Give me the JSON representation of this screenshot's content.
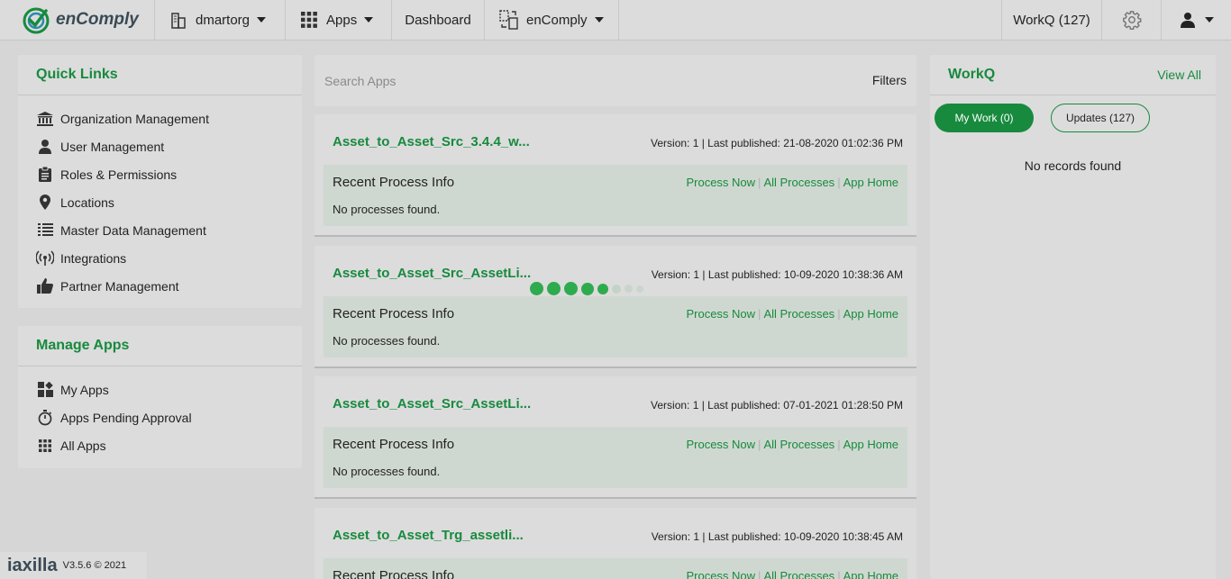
{
  "header": {
    "logo_text": "enComply",
    "org": "dmartorg",
    "apps_menu": "Apps",
    "dashboard": "Dashboard",
    "product": "enComply",
    "workq": "WorkQ (127)"
  },
  "quick_links": {
    "title": "Quick Links",
    "items": [
      {
        "label": "Organization Management",
        "icon": "bank-icon"
      },
      {
        "label": "User Management",
        "icon": "user-icon"
      },
      {
        "label": "Roles & Permissions",
        "icon": "clipboard-icon"
      },
      {
        "label": "Locations",
        "icon": "map-pin-icon"
      },
      {
        "label": "Master Data Management",
        "icon": "data-list-icon"
      },
      {
        "label": "Integrations",
        "icon": "broadcast-icon"
      },
      {
        "label": "Partner Management",
        "icon": "thumbs-up-icon"
      }
    ]
  },
  "manage_apps": {
    "title": "Manage Apps",
    "items": [
      {
        "label": "My Apps",
        "icon": "app-tiles-icon"
      },
      {
        "label": "Apps Pending Approval",
        "icon": "stopwatch-icon"
      },
      {
        "label": "All Apps",
        "icon": "grid-icon"
      }
    ]
  },
  "search": {
    "placeholder": "Search Apps",
    "filters_label": "Filters"
  },
  "apps": [
    {
      "name": "Asset_to_Asset_Src_3.4.4_w...",
      "meta": "Version: 1 | Last published: 21-08-2020 01:02:36 PM",
      "recent_title": "Recent Process Info",
      "process_now": "Process Now",
      "all_processes": "All Processes",
      "app_home": "App Home",
      "empty": "No processes found."
    },
    {
      "name": "Asset_to_Asset_Src_AssetLi...",
      "meta": "Version: 1 | Last published: 10-09-2020 10:38:36 AM",
      "recent_title": "Recent Process Info",
      "process_now": "Process Now",
      "all_processes": "All Processes",
      "app_home": "App Home",
      "empty": "No processes found."
    },
    {
      "name": "Asset_to_Asset_Src_AssetLi...",
      "meta": "Version: 1 | Last published: 07-01-2021 01:28:50 PM",
      "recent_title": "Recent Process Info",
      "process_now": "Process Now",
      "all_processes": "All Processes",
      "app_home": "App Home",
      "empty": "No processes found."
    },
    {
      "name": "Asset_to_Asset_Trg_assetli...",
      "meta": "Version: 1 | Last published: 10-09-2020 10:38:45 AM",
      "recent_title": "Recent Process Info",
      "process_now": "Process Now",
      "all_processes": "All Processes",
      "app_home": "App Home",
      "empty": ""
    }
  ],
  "workq": {
    "title": "WorkQ",
    "view_all": "View All",
    "my_work": "My Work (0)",
    "updates": "Updates (127)",
    "empty": "No records found"
  },
  "footer": {
    "brand": "iaxilla",
    "version": "V3.5.6 © 2021"
  },
  "colors": {
    "accent": "#178a3e",
    "loader": "#2eab4e",
    "overlay_bg": "#d6d6d6"
  }
}
